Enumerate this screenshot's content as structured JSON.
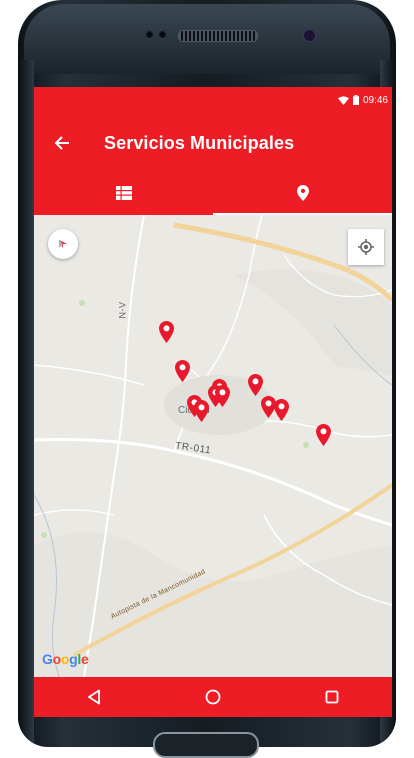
{
  "status_bar": {
    "time": "09:46"
  },
  "app_bar": {
    "title": "Servicios Municipales",
    "back_icon": "arrow-left-icon",
    "tabs": [
      {
        "icon": "list-icon",
        "active": false
      },
      {
        "icon": "location-pin-icon",
        "active": true
      }
    ]
  },
  "map": {
    "road_label_vertical": "N-V",
    "road_label_main": "TR-011",
    "road_label_diagonal": "Autopista de la Mancomunidad",
    "town_label": "Ciudad",
    "logo_text": "Google",
    "compass_icon": "compass-icon",
    "locate_icon": "my-location-icon",
    "marker_count": 11
  },
  "nav_bar": {
    "back_icon": "triangle-back-icon",
    "home_icon": "circle-home-icon",
    "recents_icon": "square-recents-icon"
  },
  "colors": {
    "accent": "#ee1c25",
    "marker": "#e8192c",
    "map_background": "#ebe9e4",
    "road_major": "#f2d49a"
  }
}
